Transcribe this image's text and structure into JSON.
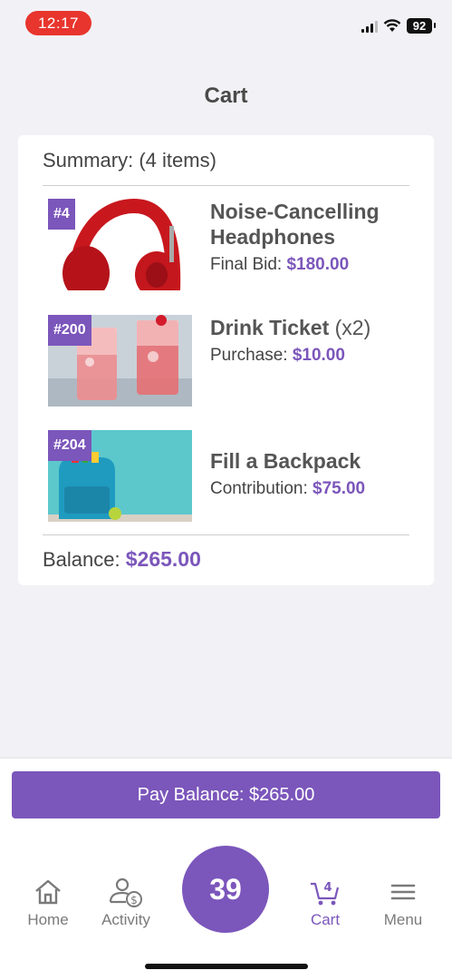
{
  "status_bar": {
    "time": "12:17",
    "battery": "92"
  },
  "page": {
    "title": "Cart"
  },
  "cart": {
    "summary": "Summary: (4 items)",
    "items": [
      {
        "badge": "#4",
        "name": "Noise-Cancelling Headphones",
        "qty": "",
        "price_label": "Final Bid:",
        "price": "$180.00",
        "image": "red-headphones-image"
      },
      {
        "badge": "#200",
        "name": "Drink Ticket",
        "qty": "(x2)",
        "price_label": "Purchase:",
        "price": "$10.00",
        "image": "red-drinks-image"
      },
      {
        "badge": "#204",
        "name": "Fill a Backpack",
        "qty": "",
        "price_label": "Contribution:",
        "price": "$75.00",
        "image": "blue-backpack-image"
      }
    ],
    "balance_label": "Balance:",
    "balance_value": "$265.00"
  },
  "pay_button": {
    "label": "Pay Balance: $265.00"
  },
  "bottom_nav": {
    "home": "Home",
    "activity": "Activity",
    "center_number": "39",
    "cart": "Cart",
    "cart_count": "4",
    "menu": "Menu"
  },
  "colors": {
    "accent": "#7b56bb",
    "time_pill": "#e8352d"
  }
}
